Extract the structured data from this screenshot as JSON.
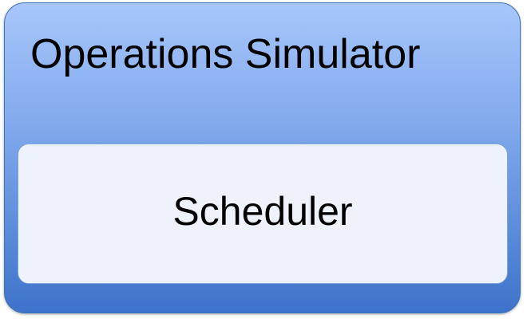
{
  "diagram": {
    "outer": {
      "label": "Operations Simulator",
      "gradient_top": "#a7c6fb",
      "gradient_bottom": "#3d73c9"
    },
    "inner": {
      "label": "Scheduler",
      "fill": "#eef3fb"
    }
  }
}
